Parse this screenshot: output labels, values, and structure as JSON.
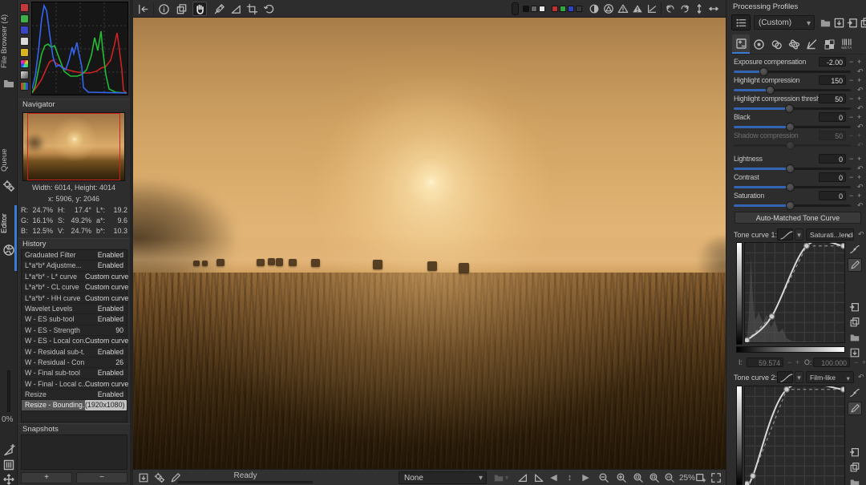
{
  "left_tabs": {
    "file_browser": "File Browser (4)",
    "queue": "Queue",
    "editor": "Editor",
    "progress": "0%"
  },
  "navigator": {
    "title": "Navigator",
    "size": "Width: 6014, Height: 4014",
    "cursor": "x: 5906, y: 2046",
    "values": {
      "r_label": "R:",
      "r": "24.7%",
      "g_label": "G:",
      "g": "16.1%",
      "b_label": "B:",
      "b": "12.5%",
      "h_label": "H:",
      "h": "17.4°",
      "s_label": "S:",
      "s": "49.2%",
      "v_label": "V:",
      "v": "24.7%",
      "l_label": "L*:",
      "l": "19.2",
      "a_label": "a*:",
      "a": "9.6",
      "bb_label": "b*:",
      "bb": "10.3"
    }
  },
  "history": {
    "title": "History",
    "items": [
      {
        "label": "Graduated Filter",
        "value": "Enabled"
      },
      {
        "label": "L*a*b* Adjustme...",
        "value": "Enabled"
      },
      {
        "label": "L*a*b* - L* curve",
        "value": "Custom curve"
      },
      {
        "label": "L*a*b* - CL curve",
        "value": "Custom curve"
      },
      {
        "label": "L*a*b* - HH curve",
        "value": "Custom curve"
      },
      {
        "label": "Wavelet Levels",
        "value": "Enabled"
      },
      {
        "label": "W - ES sub-tool",
        "value": "Enabled"
      },
      {
        "label": "W - ES - Strength",
        "value": "90"
      },
      {
        "label": "W - ES - Local con...",
        "value": "Custom curve"
      },
      {
        "label": "W - Residual sub-t...",
        "value": "Enabled"
      },
      {
        "label": "W - Residual - Con...",
        "value": "26"
      },
      {
        "label": "W - Final sub-tool",
        "value": "Enabled"
      },
      {
        "label": "W - Final - Local c...",
        "value": "Custom curve"
      },
      {
        "label": "Resize",
        "value": "Enabled"
      },
      {
        "label": "Resize - Bounding...",
        "value": "(1920x1080)"
      }
    ]
  },
  "snapshots": {
    "title": "Snapshots",
    "add": "+",
    "remove": "−"
  },
  "statusbar": {
    "status": "Ready",
    "profile": "None",
    "zoom": "25%"
  },
  "right": {
    "header": "Processing Profiles",
    "profile_value": "(Custom)",
    "meta_tab_label": "META",
    "sliders": [
      {
        "label": "Exposure compensation",
        "value": "-2.00"
      },
      {
        "label": "Highlight compression",
        "value": "150"
      },
      {
        "label": "Highlight compression threshold",
        "value": "50"
      },
      {
        "label": "Black",
        "value": "0"
      },
      {
        "label": "Shadow compression",
        "value": "50"
      },
      {
        "label": "Lightness",
        "value": "0"
      },
      {
        "label": "Contrast",
        "value": "0"
      },
      {
        "label": "Saturation",
        "value": "0"
      }
    ],
    "auto_button": "Auto-Matched Tone Curve",
    "tone_curve_1": {
      "label": "Tone curve 1:",
      "mode": "Saturati...lending",
      "points": [
        [
          0.02,
          0.02
        ],
        [
          0.27,
          0.26
        ],
        [
          0.62,
          0.97
        ],
        [
          0.99,
          0.97
        ]
      ]
    },
    "curve1_io": {
      "i_label": "I:",
      "i": "59.574",
      "o_label": "O:",
      "o": "100.000"
    },
    "tone_curve_2": {
      "label": "Tone curve 2:",
      "mode": "Film-like",
      "points": [
        [
          0.02,
          0.02
        ],
        [
          0.08,
          0.1
        ],
        [
          0.42,
          0.97
        ],
        [
          0.99,
          0.97
        ]
      ]
    }
  },
  "icons": {
    "minus": "−",
    "plus": "+",
    "dropdown": "▾",
    "reset": "↶",
    "prev": "◀",
    "next": "▶",
    "updown": "↕"
  }
}
